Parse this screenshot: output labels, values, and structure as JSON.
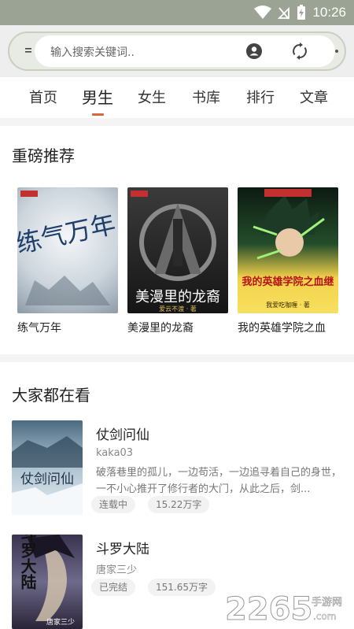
{
  "status": {
    "time": "10:26"
  },
  "search": {
    "placeholder": "输入搜索关键词.."
  },
  "tabs": [
    {
      "label": "首页"
    },
    {
      "label": "男生"
    },
    {
      "label": "女生"
    },
    {
      "label": "书库"
    },
    {
      "label": "排行"
    },
    {
      "label": "文章"
    }
  ],
  "featured": {
    "title": "重磅推荐",
    "books": [
      {
        "title": "练气万年",
        "cover_text": "练气万年"
      },
      {
        "title": "美漫里的龙裔",
        "cover_text": "美漫里的龙裔",
        "cover_author": "爱云不渡 · 著"
      },
      {
        "title": "我的英雄学院之血",
        "cover_text": "我的英雄学院之血继",
        "cover_author": "我爱吃咖喱 · 著"
      }
    ]
  },
  "popular": {
    "title": "大家都在看",
    "items": [
      {
        "title": "仗剑问仙",
        "author": "kaka03",
        "description": "破落巷里的孤儿，一边苟活，一边追寻着自己的身世，一不小心推开了修行者的大门，从此之后，剑...",
        "status": "连载中",
        "words": "15.22万字",
        "cover_text": "仗剑问仙"
      },
      {
        "title": "斗罗大陆",
        "author": "唐家三少",
        "description": "",
        "status": "已完结",
        "words": "151.65万字",
        "cover_text": "斗罗大陆",
        "cover_author": "唐家三少"
      }
    ]
  },
  "watermark": {
    "number": "2265",
    "suffix": "手游网",
    "domain": ".com"
  },
  "colors": {
    "accent": "#d9673a",
    "statusbar": "#9aa394"
  }
}
